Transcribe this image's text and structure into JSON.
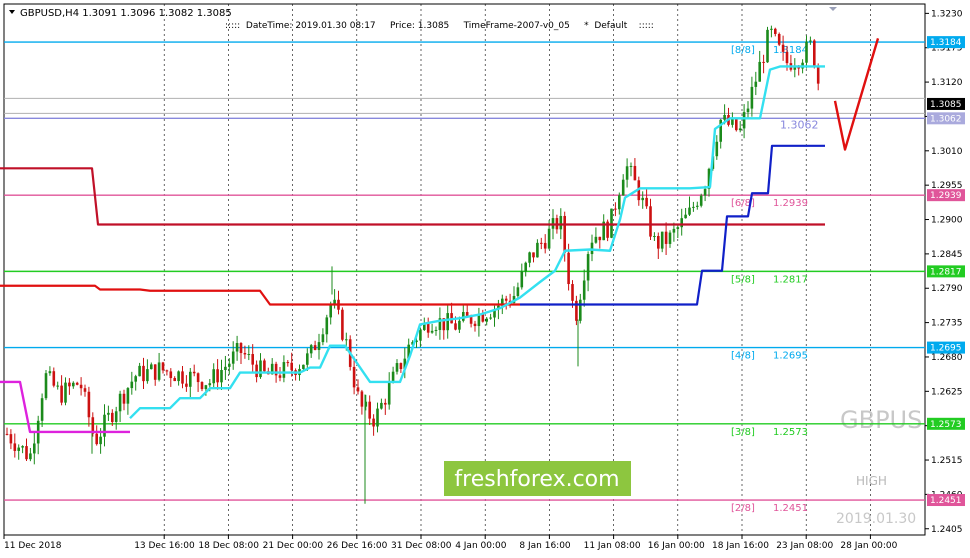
{
  "chart_data": {
    "type": "candlestick",
    "symbol_header": "GBPUSD,H4  1.3091 1.3096 1.3082 1.3085",
    "info_line": ":::::  DateTime: 2019.01.30 08:17     Price: 1.3085     TimeFrame-2007-v0_05     *  Default    :::::",
    "watermark_symbol": "GBPUS",
    "watermark_high": "HIGH",
    "watermark_date": "2019.01.30",
    "brand": "freshforex.com",
    "ylim": [
      1.2395,
      1.3245
    ],
    "y_ticks": [
      "1.3230",
      "1.3175",
      "1.3120",
      "1.3065",
      "1.3010",
      "1.2955",
      "1.2900",
      "1.2845",
      "1.2790",
      "1.2735",
      "1.2680",
      "1.2625",
      "1.2570",
      "1.2515",
      "1.2460",
      "1.2405"
    ],
    "x_ticks": [
      "11 Dec 2018",
      "13 Dec 16:00",
      "18 Dec 08:00",
      "21 Dec 00:00",
      "26 Dec 16:00",
      "31 Dec 08:00",
      "4 Jan 00:00",
      "8 Jan 16:00",
      "11 Jan 08:00",
      "16 Jan 00:00",
      "18 Jan 16:00",
      "23 Jan 08:00",
      "28 Jan 00:00"
    ],
    "current_price": "1.3085",
    "murrey_levels": [
      {
        "name": "[8/8]",
        "price": 1.3184,
        "label": "1.3184",
        "text": "1.3184",
        "color": "#00aaee"
      },
      {
        "name": "[6/8]",
        "price": 1.2939,
        "label": "1.2939",
        "text": "1.2939",
        "color": "#e0559a"
      },
      {
        "name": "[5/8]",
        "price": 1.2817,
        "label": "1.2817",
        "text": "1.2817",
        "color": "#22cc22"
      },
      {
        "name": "[4/8]",
        "price": 1.2695,
        "label": "1.2695",
        "text": "1.2695",
        "color": "#00aaee"
      },
      {
        "name": "[3/8]",
        "price": 1.2573,
        "label": "1.2573",
        "text": "1.2573",
        "color": "#22cc22"
      },
      {
        "name": "[2/8]",
        "price": 1.2451,
        "label": "1.2451",
        "text": "1.2451",
        "color": "#e0559a"
      }
    ],
    "extra_levels": [
      {
        "price": 1.3062,
        "label": "1.3062",
        "color": "#8888dd"
      }
    ],
    "dark_red_line": [
      [
        0,
        1.2982
      ],
      [
        92,
        1.2982
      ],
      [
        98,
        1.2892
      ],
      [
        825,
        1.2892
      ]
    ],
    "red_line": [
      [
        0,
        1.2794
      ],
      [
        95,
        1.2794
      ],
      [
        100,
        1.2788
      ],
      [
        140,
        1.2788
      ],
      [
        150,
        1.2786
      ],
      [
        260,
        1.2786
      ],
      [
        270,
        1.2764
      ],
      [
        520,
        1.2764
      ]
    ],
    "blue_line": [
      [
        520,
        1.2764
      ],
      [
        697,
        1.2764
      ],
      [
        702,
        1.2818
      ],
      [
        722,
        1.2818
      ],
      [
        727,
        1.2905
      ],
      [
        748,
        1.2905
      ],
      [
        752,
        1.2942
      ],
      [
        768,
        1.2942
      ],
      [
        772,
        1.3018
      ],
      [
        825,
        1.3018
      ]
    ],
    "cyan_line": [
      [
        130,
        1.2582
      ],
      [
        140,
        1.2598
      ],
      [
        170,
        1.2598
      ],
      [
        180,
        1.2614
      ],
      [
        200,
        1.2614
      ],
      [
        210,
        1.263
      ],
      [
        230,
        1.263
      ],
      [
        240,
        1.2655
      ],
      [
        300,
        1.2655
      ],
      [
        310,
        1.2663
      ],
      [
        320,
        1.2663
      ],
      [
        330,
        1.2698
      ],
      [
        345,
        1.2698
      ],
      [
        370,
        1.264
      ],
      [
        400,
        1.264
      ],
      [
        410,
        1.2682
      ],
      [
        420,
        1.2732
      ],
      [
        440,
        1.2738
      ],
      [
        460,
        1.2742
      ],
      [
        480,
        1.2748
      ],
      [
        500,
        1.2758
      ],
      [
        520,
        1.2775
      ],
      [
        540,
        1.28
      ],
      [
        555,
        1.2818
      ],
      [
        565,
        1.285
      ],
      [
        590,
        1.2852
      ],
      [
        610,
        1.285
      ],
      [
        620,
        1.29
      ],
      [
        625,
        1.2935
      ],
      [
        640,
        1.295
      ],
      [
        690,
        1.295
      ],
      [
        710,
        1.2952
      ],
      [
        715,
        1.3045
      ],
      [
        730,
        1.3062
      ],
      [
        760,
        1.3062
      ],
      [
        770,
        1.314
      ],
      [
        780,
        1.3145
      ],
      [
        825,
        1.3145
      ]
    ],
    "magenta_line": [
      [
        0,
        1.264
      ],
      [
        20,
        1.264
      ],
      [
        30,
        1.256
      ],
      [
        130,
        1.256
      ]
    ],
    "forecast_v": [
      [
        835,
        1.309
      ],
      [
        845,
        1.3012
      ],
      [
        878,
        1.319
      ]
    ],
    "candle_path": [
      [
        5,
        1.256
      ],
      [
        30,
        1.252
      ],
      [
        45,
        1.265
      ],
      [
        60,
        1.262
      ],
      [
        80,
        1.264
      ],
      [
        95,
        1.2545
      ],
      [
        115,
        1.26
      ],
      [
        135,
        1.265
      ],
      [
        160,
        1.266
      ],
      [
        185,
        1.265
      ],
      [
        210,
        1.264
      ],
      [
        240,
        1.269
      ],
      [
        265,
        1.265
      ],
      [
        290,
        1.266
      ],
      [
        310,
        1.268
      ],
      [
        332,
        1.277
      ],
      [
        345,
        1.271
      ],
      [
        360,
        1.26
      ],
      [
        375,
        1.258
      ],
      [
        392,
        1.264
      ],
      [
        410,
        1.27
      ],
      [
        430,
        1.274
      ],
      [
        455,
        1.273
      ],
      [
        475,
        1.2745
      ],
      [
        495,
        1.276
      ],
      [
        515,
        1.278
      ],
      [
        530,
        1.284
      ],
      [
        545,
        1.287
      ],
      [
        560,
        1.29
      ],
      [
        575,
        1.274
      ],
      [
        590,
        1.287
      ],
      [
        610,
        1.289
      ],
      [
        625,
        1.299
      ],
      [
        640,
        1.294
      ],
      [
        655,
        1.286
      ],
      [
        670,
        1.287
      ],
      [
        690,
        1.291
      ],
      [
        705,
        1.296
      ],
      [
        720,
        1.306
      ],
      [
        740,
        1.304
      ],
      [
        755,
        1.312
      ],
      [
        770,
        1.32
      ],
      [
        785,
        1.315
      ],
      [
        800,
        1.316
      ],
      [
        812,
        1.318
      ],
      [
        822,
        1.3085
      ]
    ]
  }
}
